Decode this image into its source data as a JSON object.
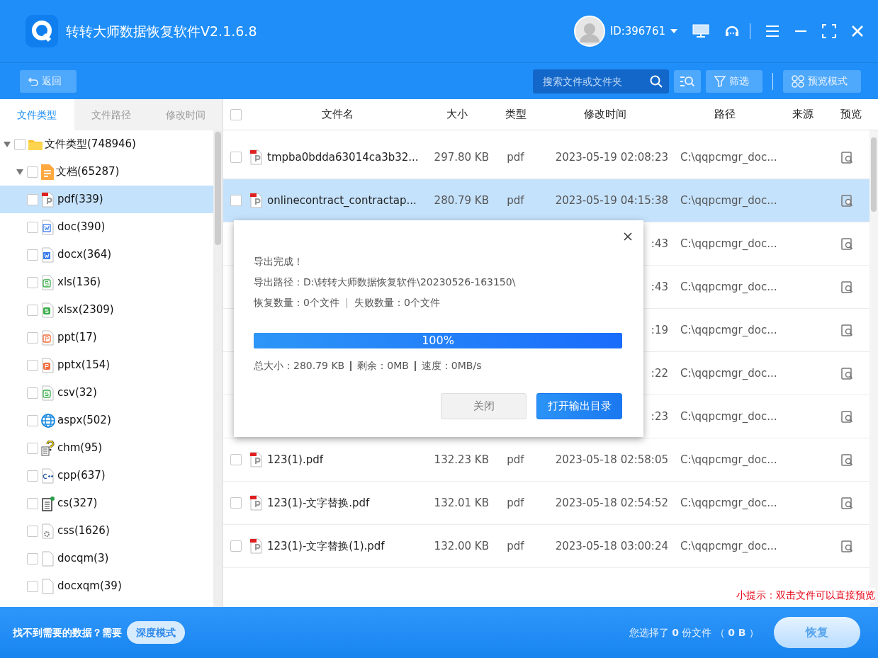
{
  "window": {
    "title": "转转大师数据恢复软件V2.1.6.8"
  },
  "account": {
    "id": "ID:396761"
  },
  "toolbar": {
    "back": "返回",
    "search": {
      "placeholder": "搜索文件或文件夹"
    },
    "filter": "筛选",
    "preview_mode": "预览模式"
  },
  "sidebar": {
    "tabs": [
      {
        "label": "文件类型",
        "selected": true
      },
      {
        "label": "文件路径",
        "selected": false
      },
      {
        "label": "修改时间",
        "selected": false
      }
    ],
    "tree": [
      {
        "label": "文件类型(748946)",
        "kind": "folder",
        "expanded": true,
        "checked": false,
        "selected": false,
        "children": [
          {
            "label": "文档(65287)",
            "kind": "doc",
            "expanded": true,
            "checked": false,
            "selected": false,
            "children": [
              {
                "label": "pdf(339)",
                "kind": "pdf",
                "checked": false,
                "selected": true
              },
              {
                "label": "doc(390)",
                "kind": "word",
                "checked": false,
                "selected": false
              },
              {
                "label": "docx(364)",
                "kind": "wordx",
                "checked": false,
                "selected": false
              },
              {
                "label": "xls(136)",
                "kind": "excel",
                "checked": false,
                "selected": false
              },
              {
                "label": "xlsx(2309)",
                "kind": "excelx",
                "checked": false,
                "selected": false
              },
              {
                "label": "ppt(17)",
                "kind": "ppt",
                "checked": false,
                "selected": false
              },
              {
                "label": "pptx(154)",
                "kind": "pptx",
                "checked": false,
                "selected": false
              },
              {
                "label": "csv(32)",
                "kind": "excel",
                "checked": false,
                "selected": false
              },
              {
                "label": "aspx(502)",
                "kind": "web",
                "checked": false,
                "selected": false
              },
              {
                "label": "chm(95)",
                "kind": "help",
                "checked": false,
                "selected": false
              },
              {
                "label": "cpp(637)",
                "kind": "cpp",
                "checked": false,
                "selected": false
              },
              {
                "label": "cs(327)",
                "kind": "cs",
                "checked": false,
                "selected": false
              },
              {
                "label": "css(1626)",
                "kind": "css",
                "checked": false,
                "selected": false
              },
              {
                "label": "docqm(3)",
                "kind": "blank",
                "checked": false,
                "selected": false
              },
              {
                "label": "docxqm(39)",
                "kind": "blank",
                "checked": false,
                "selected": false
              }
            ]
          }
        ]
      }
    ]
  },
  "table": {
    "columns": [
      "文件名",
      "大小",
      "类型",
      "修改时间",
      "路径",
      "来源",
      "预览"
    ],
    "header_checked": false,
    "rows": [
      {
        "name": "tmpba0bdda63014ca3b32...",
        "size": "297.80 KB",
        "type": "pdf",
        "modified": "2023-05-19 02:08:23",
        "path": "C:\\qqpcmgr_doc...",
        "checked": false,
        "selected": false
      },
      {
        "name": "onlinecontract_contractap...",
        "size": "280.79 KB",
        "type": "pdf",
        "modified": "2023-05-19 04:15:38",
        "path": "C:\\qqpcmgr_doc...",
        "checked": false,
        "selected": true
      },
      {
        "modified": ":43",
        "path": "C:\\qqpcmgr_doc...",
        "selected": false
      },
      {
        "modified": ":43",
        "path": "C:\\qqpcmgr_doc...",
        "selected": false
      },
      {
        "modified": ":19",
        "path": "C:\\qqpcmgr_doc...",
        "selected": false
      },
      {
        "modified": ":22",
        "path": "C:\\qqpcmgr_doc...",
        "selected": false
      },
      {
        "modified": ":23",
        "path": "C:\\qqpcmgr_doc...",
        "selected": false
      },
      {
        "name": "123(1).pdf",
        "size": "132.23 KB",
        "type": "pdf",
        "modified": "2023-05-18 02:58:05",
        "path": "C:\\qqpcmgr_doc...",
        "checked": false,
        "selected": false
      },
      {
        "name": "123(1)-文字替换.pdf",
        "size": "132.01 KB",
        "type": "pdf",
        "modified": "2023-05-18 02:54:52",
        "path": "C:\\qqpcmgr_doc...",
        "checked": false,
        "selected": false
      },
      {
        "name": "123(1)-文字替换(1).pdf",
        "size": "132.00 KB",
        "type": "pdf",
        "modified": "2023-05-18 03:00:24",
        "path": "C:\\qqpcmgr_doc...",
        "checked": false,
        "selected": false
      }
    ]
  },
  "hint": "小提示：双击文件可以直接预览",
  "dialog": {
    "heading": "导出完成！",
    "path": "导出路径：D:\\转转大师数据恢复软件\\20230526-163150\\",
    "counts": [
      "恢复数量：0个文件",
      "失败数量：0个文件"
    ],
    "progress": {
      "level": 1,
      "label": "100%"
    },
    "details": [
      "总大小：280.79 KB",
      "剩余：0MB",
      "速度：0MB/s"
    ],
    "buttons": [
      {
        "label": "关闭",
        "kind": "secondary"
      },
      {
        "label": "打开输出目录",
        "kind": "primary"
      }
    ]
  },
  "footer": {
    "prompt": "找不到需要的数据？需要",
    "deep_mode": "深度模式",
    "selection": "您选择了 **0** 份文件 （ **0 B** ）",
    "restore": "恢复"
  }
}
